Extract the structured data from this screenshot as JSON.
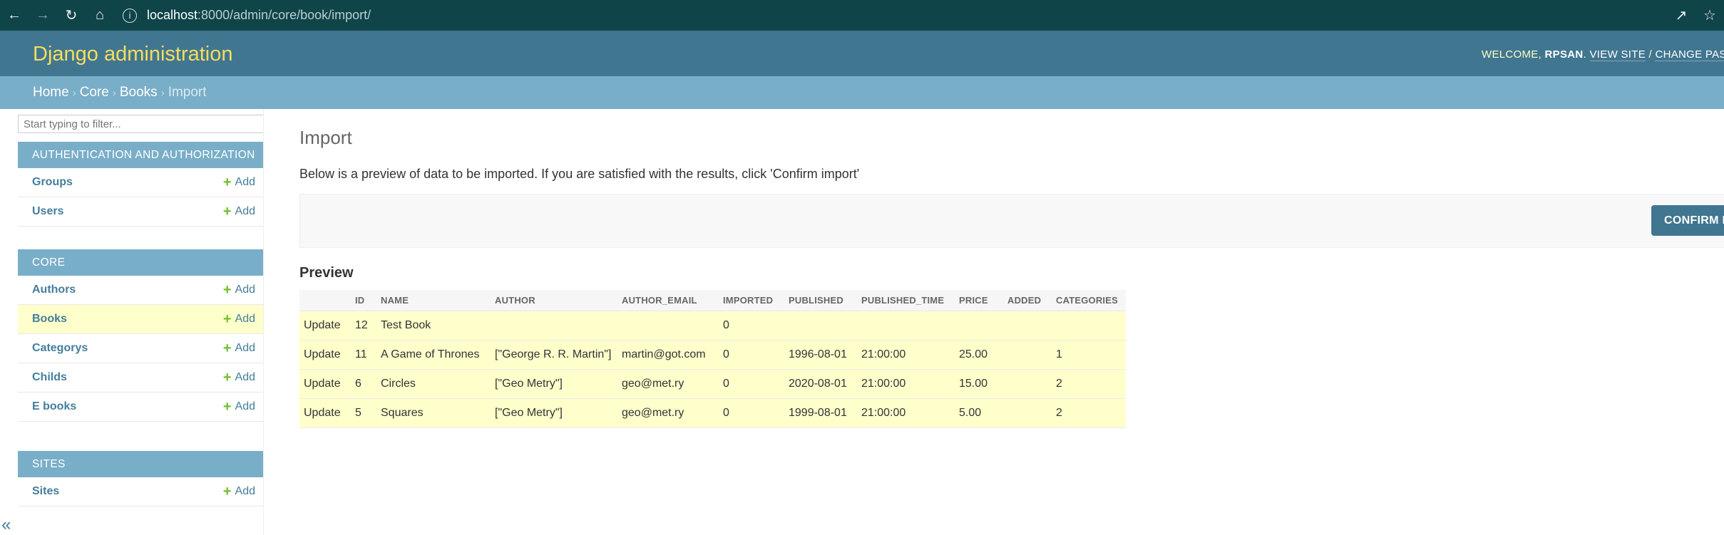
{
  "browser": {
    "url_host": "localhost",
    "url_path": ":8000/admin/core/book/import/"
  },
  "header": {
    "site_name": "Django administration",
    "welcome": "WELCOME,",
    "username": "RPSAN",
    "view_site": "VIEW SITE",
    "separator": "/",
    "change_password": "CHANGE PASSWOR"
  },
  "breadcrumbs": {
    "home": "Home",
    "core": "Core",
    "books": "Books",
    "current": "Import",
    "sep": "›"
  },
  "sidebar": {
    "filter_placeholder": "Start typing to filter...",
    "add_label": "Add",
    "modules": {
      "auth": {
        "caption": "AUTHENTICATION AND AUTHORIZATION",
        "items": [
          "Groups",
          "Users"
        ]
      },
      "core": {
        "caption": "CORE",
        "items": [
          "Authors",
          "Books",
          "Categorys",
          "Childs",
          "E books"
        ]
      },
      "sites": {
        "caption": "SITES",
        "items": [
          "Sites"
        ]
      }
    },
    "collapse": "«"
  },
  "main": {
    "title": "Import",
    "intro": "Below is a preview of data to be imported. If you are satisfied with the results, click 'Confirm import'",
    "confirm_button": "CONFIRM IMPORT",
    "preview_heading": "Preview",
    "columns": [
      "",
      "ID",
      "NAME",
      "AUTHOR",
      "AUTHOR_EMAIL",
      "IMPORTED",
      "PUBLISHED",
      "PUBLISHED_TIME",
      "PRICE",
      "ADDED",
      "CATEGORIES"
    ],
    "rows": [
      [
        "Update",
        "12",
        "Test Book",
        "",
        "",
        "0",
        "",
        "",
        "",
        "",
        ""
      ],
      [
        "Update",
        "11",
        "A Game of Thrones",
        "[\"George R. R. Martin\"]",
        "martin@got.com",
        "0",
        "1996-08-01",
        "21:00:00",
        "25.00",
        "",
        "1"
      ],
      [
        "Update",
        "6",
        "Circles",
        "[\"Geo Metry\"]",
        "geo@met.ry",
        "0",
        "2020-08-01",
        "21:00:00",
        "15.00",
        "",
        "2"
      ],
      [
        "Update",
        "5",
        "Squares",
        "[\"Geo Metry\"]",
        "geo@met.ry",
        "0",
        "1999-08-01",
        "21:00:00",
        "5.00",
        "",
        "2"
      ]
    ]
  },
  "colors": {
    "header_bg": "#417690",
    "breadcrumb_bg": "#79aec8",
    "branding": "#f5dd5d",
    "row_highlight": "#ffffcc",
    "add_icon": "#70bf2b"
  }
}
